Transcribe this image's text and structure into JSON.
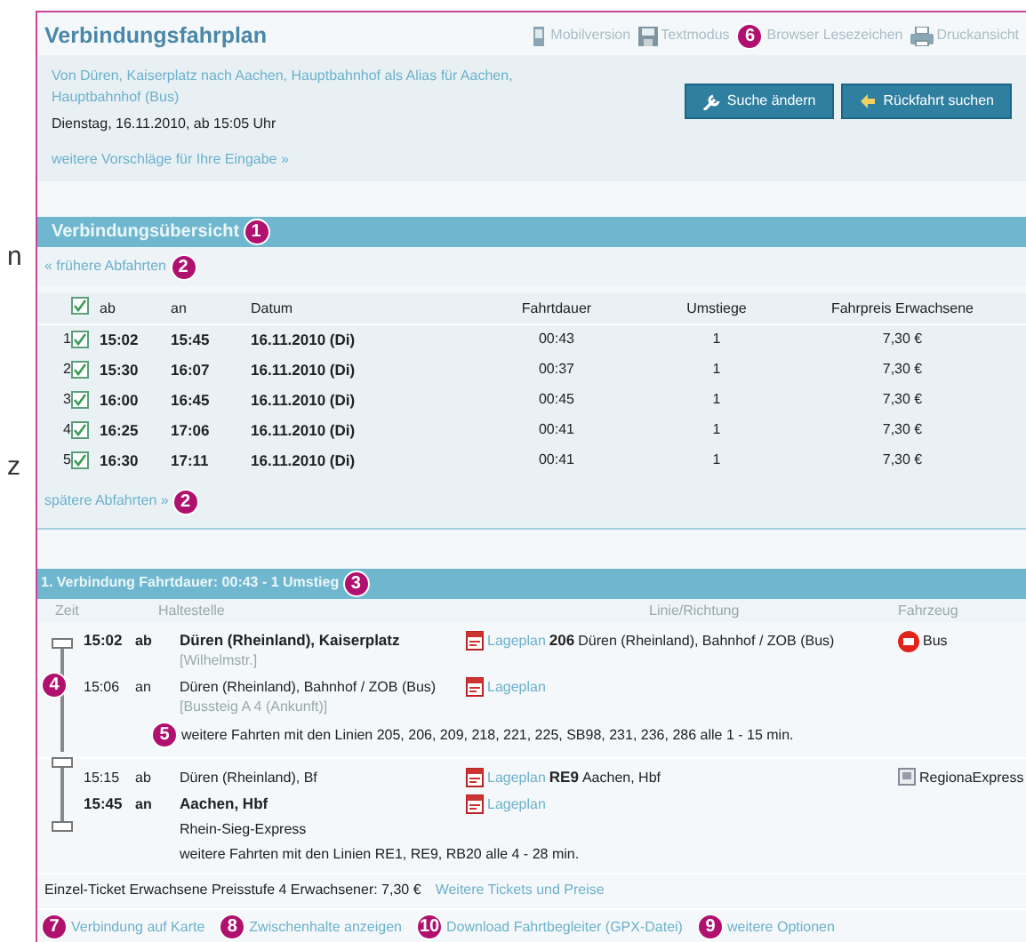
{
  "margin_letters": [
    "n",
    "z"
  ],
  "header": {
    "title": "Verbindungsfahrplan",
    "tools": [
      {
        "label": "Mobilversion"
      },
      {
        "label": "Textmodus"
      },
      {
        "label": "Browser Lesezeichen",
        "marker": "6"
      },
      {
        "label": "Druckansicht"
      }
    ]
  },
  "search": {
    "route": "Von Düren, Kaiserplatz nach Aachen, Hauptbahnhof als Alias für Aachen, Hauptbahnhof (Bus)",
    "date": "Dienstag, 16.11.2010, ab 15:05 Uhr",
    "more_link": "weitere Vorschläge für Ihre Eingabe »",
    "buttons": [
      {
        "label": "Suche ändern"
      },
      {
        "label": "Rückfahrt suchen"
      }
    ]
  },
  "overview": {
    "title": "Verbindungsübersicht",
    "marker": "1",
    "earlier": {
      "label": "« frühere Abfahrten",
      "marker": "2"
    },
    "header_checked": true,
    "columns": [
      "ab",
      "an",
      "Datum",
      "Fahrtdauer",
      "Umstiege",
      "Fahrpreis Erwachsene"
    ],
    "rows": [
      {
        "index": "1",
        "checked": true,
        "ab": "15:02",
        "an": "15:45",
        "date": "16.11.2010 (Di)",
        "duration": "00:43",
        "changes": "1",
        "fare": "7,30 €"
      },
      {
        "index": "2",
        "checked": true,
        "ab": "15:30",
        "an": "16:07",
        "date": "16.11.2010 (Di)",
        "duration": "00:37",
        "changes": "1",
        "fare": "7,30 €"
      },
      {
        "index": "3",
        "checked": true,
        "ab": "16:00",
        "an": "16:45",
        "date": "16.11.2010 (Di)",
        "duration": "00:45",
        "changes": "1",
        "fare": "7,30 €"
      },
      {
        "index": "4",
        "checked": true,
        "ab": "16:25",
        "an": "17:06",
        "date": "16.11.2010 (Di)",
        "duration": "00:41",
        "changes": "1",
        "fare": "7,30 €"
      },
      {
        "index": "5",
        "checked": true,
        "ab": "16:30",
        "an": "17:11",
        "date": "16.11.2010 (Di)",
        "duration": "00:41",
        "changes": "1",
        "fare": "7,30 €"
      }
    ],
    "later": {
      "label": "spätere Abfahrten »",
      "marker": "2"
    }
  },
  "detail": {
    "title": "1. Verbindung  Fahrtdauer: 00:43 - 1 Umstieg",
    "marker": "3",
    "columns": [
      "Zeit",
      "Haltestelle",
      "Linie/Richtung",
      "Fahrzeug"
    ],
    "timeline_marker": "4",
    "legs": [
      {
        "dep": {
          "time": "15:02",
          "type": "ab",
          "stop": "Düren (Rheinland), Kaiserplatz",
          "strong": true,
          "note": "[Wilhelmstr.]",
          "map": "Lageplan"
        },
        "line": "206",
        "direction": "Düren (Rheinland), Bahnhof / ZOB (Bus)",
        "vehicle": "Bus",
        "kind": "bus",
        "arr": {
          "time": "15:06",
          "type": "an",
          "stop": "Düren (Rheinland), Bahnhof / ZOB (Bus)",
          "strong": false,
          "note": "[Bussteig A 4 (Ankunft)]",
          "map": "Lageplan"
        },
        "more": "weitere Fahrten mit den Linien 205, 206, 209, 218, 221, 225, SB98, 231, 236, 286 alle 1 - 15 min.",
        "more_marker": "5"
      },
      {
        "dep": {
          "time": "15:15",
          "type": "ab",
          "stop": "Düren (Rheinland), Bf",
          "strong": false,
          "map": "Lageplan"
        },
        "line": "RE9",
        "direction": "Aachen, Hbf",
        "vehicle": "RegionaExpress",
        "kind": "train",
        "arr": {
          "time": "15:45",
          "type": "an",
          "stop": "Aachen, Hbf",
          "strong": true,
          "map": "Lageplan"
        },
        "train_name": "Rhein-Sieg-Express",
        "more": "weitere Fahrten mit den Linien RE1, RE9, RB20 alle 4 - 28 min."
      }
    ],
    "ticket": "Einzel-Ticket Erwachsene Preisstufe 4 Erwachsener: 7,30 €",
    "ticket_link": "Weitere Tickets und Preise"
  },
  "footer_links": [
    {
      "label": "Verbindung auf Karte",
      "marker": "7"
    },
    {
      "label": "Zwischenhalte anzeigen",
      "marker": "8"
    },
    {
      "label": "Download Fahrtbegleiter (GPX-Datei)",
      "marker": "10"
    },
    {
      "label": "weitere Optionen",
      "marker": "9"
    }
  ]
}
